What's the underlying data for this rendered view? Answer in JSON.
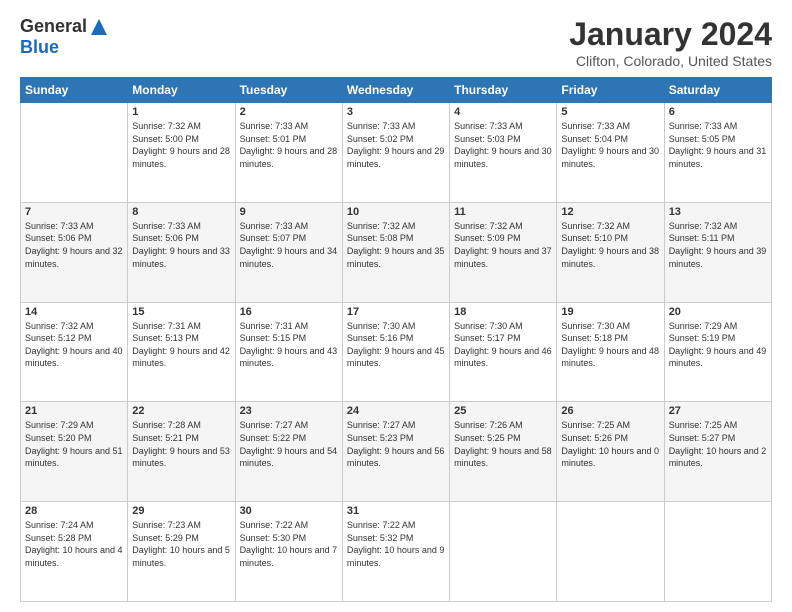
{
  "header": {
    "logo": {
      "general": "General",
      "blue": "Blue"
    },
    "title": "January 2024",
    "location": "Clifton, Colorado, United States"
  },
  "weekdays": [
    "Sunday",
    "Monday",
    "Tuesday",
    "Wednesday",
    "Thursday",
    "Friday",
    "Saturday"
  ],
  "weeks": [
    [
      {
        "day": "",
        "sunrise": "",
        "sunset": "",
        "daylight": ""
      },
      {
        "day": "1",
        "sunrise": "Sunrise: 7:32 AM",
        "sunset": "Sunset: 5:00 PM",
        "daylight": "Daylight: 9 hours and 28 minutes."
      },
      {
        "day": "2",
        "sunrise": "Sunrise: 7:33 AM",
        "sunset": "Sunset: 5:01 PM",
        "daylight": "Daylight: 9 hours and 28 minutes."
      },
      {
        "day": "3",
        "sunrise": "Sunrise: 7:33 AM",
        "sunset": "Sunset: 5:02 PM",
        "daylight": "Daylight: 9 hours and 29 minutes."
      },
      {
        "day": "4",
        "sunrise": "Sunrise: 7:33 AM",
        "sunset": "Sunset: 5:03 PM",
        "daylight": "Daylight: 9 hours and 30 minutes."
      },
      {
        "day": "5",
        "sunrise": "Sunrise: 7:33 AM",
        "sunset": "Sunset: 5:04 PM",
        "daylight": "Daylight: 9 hours and 30 minutes."
      },
      {
        "day": "6",
        "sunrise": "Sunrise: 7:33 AM",
        "sunset": "Sunset: 5:05 PM",
        "daylight": "Daylight: 9 hours and 31 minutes."
      }
    ],
    [
      {
        "day": "7",
        "sunrise": "Sunrise: 7:33 AM",
        "sunset": "Sunset: 5:06 PM",
        "daylight": "Daylight: 9 hours and 32 minutes."
      },
      {
        "day": "8",
        "sunrise": "Sunrise: 7:33 AM",
        "sunset": "Sunset: 5:06 PM",
        "daylight": "Daylight: 9 hours and 33 minutes."
      },
      {
        "day": "9",
        "sunrise": "Sunrise: 7:33 AM",
        "sunset": "Sunset: 5:07 PM",
        "daylight": "Daylight: 9 hours and 34 minutes."
      },
      {
        "day": "10",
        "sunrise": "Sunrise: 7:32 AM",
        "sunset": "Sunset: 5:08 PM",
        "daylight": "Daylight: 9 hours and 35 minutes."
      },
      {
        "day": "11",
        "sunrise": "Sunrise: 7:32 AM",
        "sunset": "Sunset: 5:09 PM",
        "daylight": "Daylight: 9 hours and 37 minutes."
      },
      {
        "day": "12",
        "sunrise": "Sunrise: 7:32 AM",
        "sunset": "Sunset: 5:10 PM",
        "daylight": "Daylight: 9 hours and 38 minutes."
      },
      {
        "day": "13",
        "sunrise": "Sunrise: 7:32 AM",
        "sunset": "Sunset: 5:11 PM",
        "daylight": "Daylight: 9 hours and 39 minutes."
      }
    ],
    [
      {
        "day": "14",
        "sunrise": "Sunrise: 7:32 AM",
        "sunset": "Sunset: 5:12 PM",
        "daylight": "Daylight: 9 hours and 40 minutes."
      },
      {
        "day": "15",
        "sunrise": "Sunrise: 7:31 AM",
        "sunset": "Sunset: 5:13 PM",
        "daylight": "Daylight: 9 hours and 42 minutes."
      },
      {
        "day": "16",
        "sunrise": "Sunrise: 7:31 AM",
        "sunset": "Sunset: 5:15 PM",
        "daylight": "Daylight: 9 hours and 43 minutes."
      },
      {
        "day": "17",
        "sunrise": "Sunrise: 7:30 AM",
        "sunset": "Sunset: 5:16 PM",
        "daylight": "Daylight: 9 hours and 45 minutes."
      },
      {
        "day": "18",
        "sunrise": "Sunrise: 7:30 AM",
        "sunset": "Sunset: 5:17 PM",
        "daylight": "Daylight: 9 hours and 46 minutes."
      },
      {
        "day": "19",
        "sunrise": "Sunrise: 7:30 AM",
        "sunset": "Sunset: 5:18 PM",
        "daylight": "Daylight: 9 hours and 48 minutes."
      },
      {
        "day": "20",
        "sunrise": "Sunrise: 7:29 AM",
        "sunset": "Sunset: 5:19 PM",
        "daylight": "Daylight: 9 hours and 49 minutes."
      }
    ],
    [
      {
        "day": "21",
        "sunrise": "Sunrise: 7:29 AM",
        "sunset": "Sunset: 5:20 PM",
        "daylight": "Daylight: 9 hours and 51 minutes."
      },
      {
        "day": "22",
        "sunrise": "Sunrise: 7:28 AM",
        "sunset": "Sunset: 5:21 PM",
        "daylight": "Daylight: 9 hours and 53 minutes."
      },
      {
        "day": "23",
        "sunrise": "Sunrise: 7:27 AM",
        "sunset": "Sunset: 5:22 PM",
        "daylight": "Daylight: 9 hours and 54 minutes."
      },
      {
        "day": "24",
        "sunrise": "Sunrise: 7:27 AM",
        "sunset": "Sunset: 5:23 PM",
        "daylight": "Daylight: 9 hours and 56 minutes."
      },
      {
        "day": "25",
        "sunrise": "Sunrise: 7:26 AM",
        "sunset": "Sunset: 5:25 PM",
        "daylight": "Daylight: 9 hours and 58 minutes."
      },
      {
        "day": "26",
        "sunrise": "Sunrise: 7:25 AM",
        "sunset": "Sunset: 5:26 PM",
        "daylight": "Daylight: 10 hours and 0 minutes."
      },
      {
        "day": "27",
        "sunrise": "Sunrise: 7:25 AM",
        "sunset": "Sunset: 5:27 PM",
        "daylight": "Daylight: 10 hours and 2 minutes."
      }
    ],
    [
      {
        "day": "28",
        "sunrise": "Sunrise: 7:24 AM",
        "sunset": "Sunset: 5:28 PM",
        "daylight": "Daylight: 10 hours and 4 minutes."
      },
      {
        "day": "29",
        "sunrise": "Sunrise: 7:23 AM",
        "sunset": "Sunset: 5:29 PM",
        "daylight": "Daylight: 10 hours and 5 minutes."
      },
      {
        "day": "30",
        "sunrise": "Sunrise: 7:22 AM",
        "sunset": "Sunset: 5:30 PM",
        "daylight": "Daylight: 10 hours and 7 minutes."
      },
      {
        "day": "31",
        "sunrise": "Sunrise: 7:22 AM",
        "sunset": "Sunset: 5:32 PM",
        "daylight": "Daylight: 10 hours and 9 minutes."
      },
      {
        "day": "",
        "sunrise": "",
        "sunset": "",
        "daylight": ""
      },
      {
        "day": "",
        "sunrise": "",
        "sunset": "",
        "daylight": ""
      },
      {
        "day": "",
        "sunrise": "",
        "sunset": "",
        "daylight": ""
      }
    ]
  ]
}
